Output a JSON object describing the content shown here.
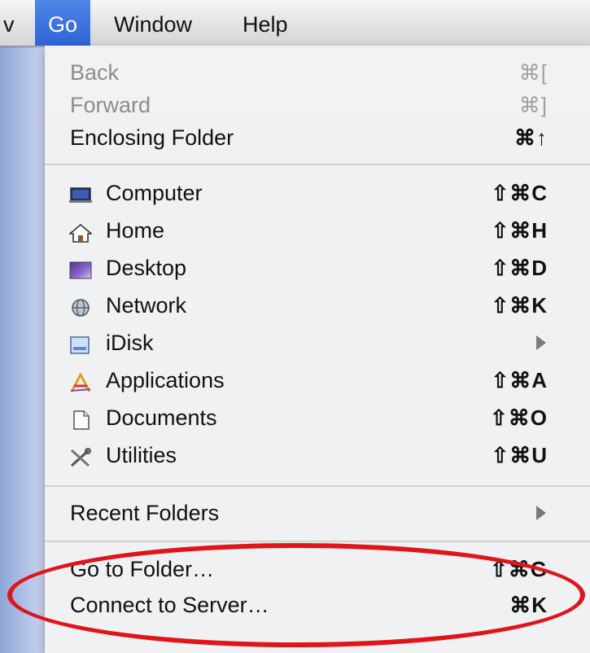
{
  "menubar": {
    "partial_left": "v",
    "items": [
      {
        "label": "Go"
      },
      {
        "label": "Window"
      },
      {
        "label": "Help"
      }
    ]
  },
  "menu": {
    "items": [
      {
        "label": "Back",
        "shortcut": "⌘[",
        "enabled": false
      },
      {
        "label": "Forward",
        "shortcut": "⌘]",
        "enabled": false
      },
      {
        "label": "Enclosing Folder",
        "shortcut": "⌘↑",
        "enabled": true
      },
      {
        "label": "Computer",
        "shortcut": "⇧⌘C",
        "icon": "computer-icon"
      },
      {
        "label": "Home",
        "shortcut": "⇧⌘H",
        "icon": "home-icon"
      },
      {
        "label": "Desktop",
        "shortcut": "⇧⌘D",
        "icon": "desktop-icon"
      },
      {
        "label": "Network",
        "shortcut": "⇧⌘K",
        "icon": "network-icon"
      },
      {
        "label": "iDisk",
        "submenu": true,
        "icon": "idisk-icon"
      },
      {
        "label": "Applications",
        "shortcut": "⇧⌘A",
        "icon": "applications-icon"
      },
      {
        "label": "Documents",
        "shortcut": "⇧⌘O",
        "icon": "documents-icon"
      },
      {
        "label": "Utilities",
        "shortcut": "⇧⌘U",
        "icon": "utilities-icon"
      },
      {
        "label": "Recent Folders",
        "submenu": true
      },
      {
        "label": "Go to Folder…",
        "shortcut": "⇧⌘G"
      },
      {
        "label": "Connect to Server…",
        "shortcut": "⌘K"
      }
    ]
  },
  "colors": {
    "highlight": "#2f63d8",
    "annotation": "#e0151a"
  }
}
